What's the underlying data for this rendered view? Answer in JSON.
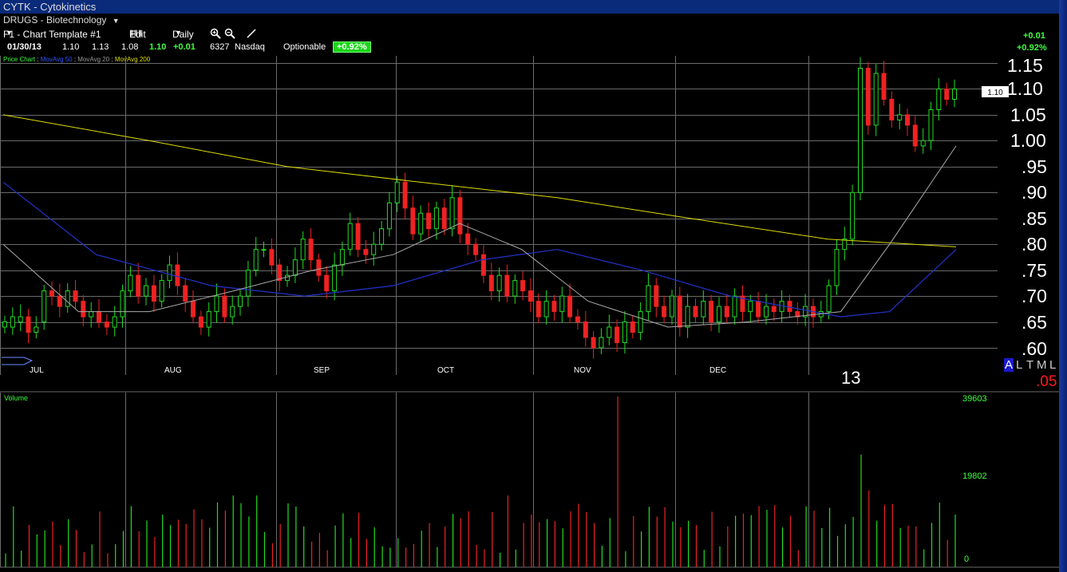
{
  "window": {
    "title": "CYTK - Cytokinetics",
    "sector": "DRUGS - Biotechnology"
  },
  "toolbar": {
    "template": "F1 - Chart Template #1",
    "edit": "Edit",
    "period": "Daily"
  },
  "quote": {
    "date": "01/30/13",
    "open": "1.10",
    "high": "1.13",
    "low": "1.08",
    "last": "1.10",
    "change": "+0.01",
    "volume": "6327",
    "exchange": "Nasdaq",
    "optionable": "Optionable",
    "pct": "+0.92%"
  },
  "indicators": {
    "label": "Price Chart",
    "sep": ":",
    "ma50": "MovAvg 50",
    "ma20": "MovAvg 20",
    "ma200": "MovAvg 200"
  },
  "header_right": {
    "change": "+0.01",
    "pct": "+0.92%"
  },
  "price_axis": {
    "labels": [
      "1.15",
      "1.10",
      "1.05",
      "1.00",
      ".95",
      ".90",
      ".85",
      ".80",
      ".75",
      ".70",
      ".65",
      ".60"
    ],
    "current": "1.10",
    "bottom": ".05"
  },
  "month_axis": {
    "labels": [
      "JUL",
      "AUG",
      "SEP",
      "OCT",
      "NOV",
      "DEC"
    ],
    "year": "13"
  },
  "scale_buttons": {
    "a": "A",
    "l": "L",
    "t": "T",
    "m": "M",
    "l2": "L"
  },
  "volume": {
    "label": "Volume",
    "max": "39603",
    "mid": "19802",
    "zero": "0"
  },
  "colors": {
    "up": "#22dd22",
    "down": "#ee2222",
    "ma20": "#aaaaaa",
    "ma50": "#2233cc",
    "ma200": "#dddd00",
    "grid": "#6a6a6a",
    "quote_green": "#3dff3d",
    "titlebar": "#0a2a7a"
  },
  "chart_data": {
    "type": "candlestick",
    "title": "CYTK - Cytokinetics",
    "period": "Daily",
    "x_range": [
      "2012-06-29",
      "2013-01-30"
    ],
    "y_range": [
      0.6,
      1.15
    ],
    "series": [
      {
        "name": "MovAvg 20",
        "values": [
          {
            "x": "2012-06-29",
            "y": 0.8
          },
          {
            "x": "2012-07-16",
            "y": 0.67
          },
          {
            "x": "2012-08-01",
            "y": 0.67
          },
          {
            "x": "2012-08-20",
            "y": 0.71
          },
          {
            "x": "2012-09-07",
            "y": 0.75
          },
          {
            "x": "2012-09-25",
            "y": 0.78
          },
          {
            "x": "2012-10-10",
            "y": 0.84
          },
          {
            "x": "2012-10-24",
            "y": 0.79
          },
          {
            "x": "2012-11-08",
            "y": 0.69
          },
          {
            "x": "2012-11-26",
            "y": 0.64
          },
          {
            "x": "2012-12-14",
            "y": 0.65
          },
          {
            "x": "2013-01-04",
            "y": 0.67
          },
          {
            "x": "2013-01-15",
            "y": 0.8
          },
          {
            "x": "2013-01-30",
            "y": 0.99
          }
        ]
      },
      {
        "name": "MovAvg 50",
        "values": [
          {
            "x": "2012-06-29",
            "y": 0.92
          },
          {
            "x": "2012-07-20",
            "y": 0.78
          },
          {
            "x": "2012-08-15",
            "y": 0.72
          },
          {
            "x": "2012-09-05",
            "y": 0.7
          },
          {
            "x": "2012-09-25",
            "y": 0.72
          },
          {
            "x": "2012-10-15",
            "y": 0.77
          },
          {
            "x": "2012-11-01",
            "y": 0.79
          },
          {
            "x": "2012-11-20",
            "y": 0.75
          },
          {
            "x": "2012-12-10",
            "y": 0.7
          },
          {
            "x": "2013-01-04",
            "y": 0.66
          },
          {
            "x": "2013-01-15",
            "y": 0.67
          },
          {
            "x": "2013-01-30",
            "y": 0.79
          }
        ]
      },
      {
        "name": "MovAvg 200",
        "values": [
          {
            "x": "2012-06-29",
            "y": 1.05
          },
          {
            "x": "2012-08-01",
            "y": 1.0
          },
          {
            "x": "2012-09-01",
            "y": 0.95
          },
          {
            "x": "2012-10-01",
            "y": 0.92
          },
          {
            "x": "2012-11-01",
            "y": 0.89
          },
          {
            "x": "2012-12-01",
            "y": 0.85
          },
          {
            "x": "2013-01-01",
            "y": 0.81
          },
          {
            "x": "2013-01-30",
            "y": 0.795
          }
        ]
      }
    ],
    "volume": {
      "max": 39603,
      "mid": 19802
    }
  }
}
